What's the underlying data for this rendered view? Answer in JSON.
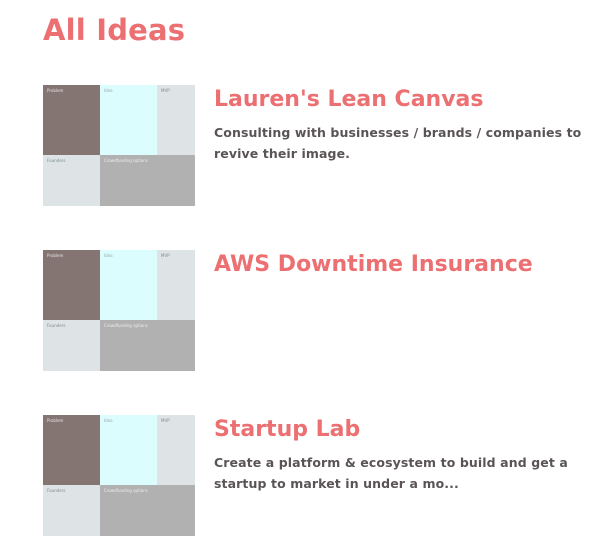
{
  "page": {
    "title": "All Ideas"
  },
  "colors": {
    "accent": "#ec6f72",
    "text": "#5a5456",
    "problem_cell": "#847573",
    "idea_cell": "#dcfdfd",
    "mvp_cell": "#dee4e5",
    "founders_cell": "#dee4e5",
    "crowdfunding_cell": "#b1b1b1"
  },
  "canvas_labels": {
    "problem": "Problem",
    "idea": "Idea",
    "mvp": "MVP",
    "founders": "Founders",
    "crowdfunding": "Crowdfunding options"
  },
  "ideas": [
    {
      "title": "Lauren's Lean Canvas",
      "description": "Consulting with businesses / brands / companies to revive their image."
    },
    {
      "title": "AWS Downtime Insurance",
      "description": ""
    },
    {
      "title": "Startup Lab",
      "description": "Create a platform & ecosystem to build and get a startup to market in under a mo..."
    }
  ]
}
